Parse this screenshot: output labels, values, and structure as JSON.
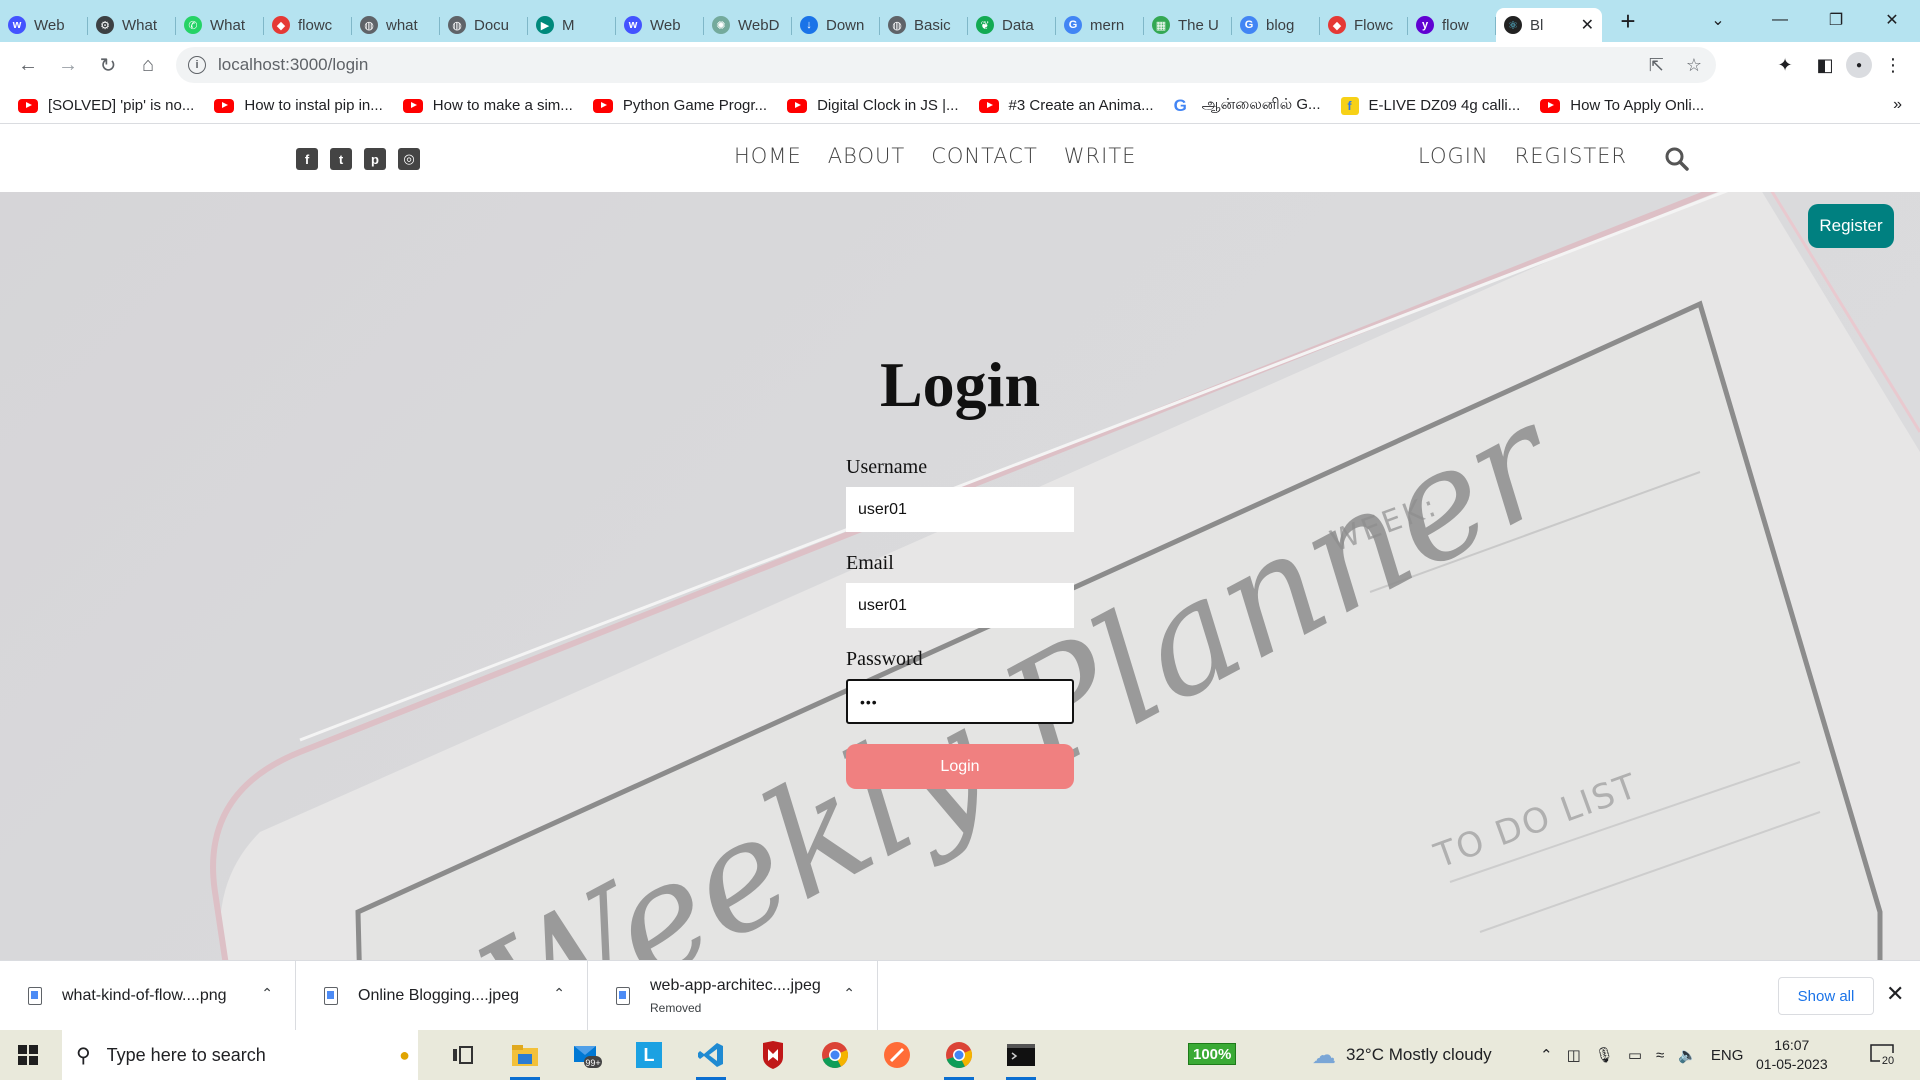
{
  "browser": {
    "tabs": [
      {
        "title": "Web",
        "icon": "webflow-icon",
        "color": "#4353ff"
      },
      {
        "title": "What",
        "icon": "robot-icon",
        "color": "#3c4043"
      },
      {
        "title": "What",
        "icon": "whatsapp-icon",
        "color": "#25d366"
      },
      {
        "title": "flowc",
        "icon": "diamond-icon",
        "color": "#e53935"
      },
      {
        "title": "what",
        "icon": "globe-icon",
        "color": "#5f6368"
      },
      {
        "title": "Docu",
        "icon": "globe-icon",
        "color": "#5f6368"
      },
      {
        "title": "M",
        "icon": "meet-icon",
        "color": "#00897b"
      },
      {
        "title": "Web",
        "icon": "webflow-icon",
        "color": "#4353ff"
      },
      {
        "title": "WebD",
        "icon": "chatgpt-icon",
        "color": "#74aa9c"
      },
      {
        "title": "Down",
        "icon": "download-icon",
        "color": "#1a73e8"
      },
      {
        "title": "Basic",
        "icon": "globe-icon",
        "color": "#5f6368"
      },
      {
        "title": "Data",
        "icon": "mongodb-icon",
        "color": "#13aa52"
      },
      {
        "title": "mern",
        "icon": "google-icon",
        "color": "#4285f4"
      },
      {
        "title": "The U",
        "icon": "sheet-icon",
        "color": "#34a853"
      },
      {
        "title": "blog",
        "icon": "google-icon",
        "color": "#4285f4"
      },
      {
        "title": "Flowc",
        "icon": "diamond-icon",
        "color": "#e53935"
      },
      {
        "title": "flow",
        "icon": "yahoo-icon",
        "color": "#6001d2"
      }
    ],
    "active_tab": {
      "title": "Bl",
      "icon": "react-icon",
      "color": "#61dafb"
    },
    "url": "localhost:3000/login",
    "bookmarks": [
      {
        "label": "[SOLVED] 'pip' is no...",
        "icon": "youtube-icon"
      },
      {
        "label": "How to instal pip in...",
        "icon": "youtube-icon"
      },
      {
        "label": "How to make a sim...",
        "icon": "youtube-icon"
      },
      {
        "label": "Python Game Progr...",
        "icon": "youtube-icon"
      },
      {
        "label": "Digital Clock in JS |...",
        "icon": "youtube-icon"
      },
      {
        "label": "#3 Create an Anima...",
        "icon": "youtube-icon"
      },
      {
        "label": "ஆன்லைனில் G...",
        "icon": "google-icon"
      },
      {
        "label": "E-LIVE DZ09 4g calli...",
        "icon": "flipkart-icon"
      },
      {
        "label": "How To Apply Onli...",
        "icon": "youtube-icon"
      }
    ]
  },
  "site": {
    "social_icons": [
      "facebook-icon",
      "twitter-icon",
      "pinterest-icon",
      "instagram-icon"
    ],
    "menu": [
      "HOME",
      "ABOUT",
      "CONTACT",
      "WRITE"
    ],
    "auth": [
      "LOGIN",
      "REGISTER"
    ],
    "register_button": "Register",
    "title": "Login",
    "form": {
      "username_label": "Username",
      "username_value": "user01",
      "email_label": "Email",
      "email_value": "user01",
      "password_label": "Password",
      "password_value": "•••",
      "submit_label": "Login"
    },
    "background_text": {
      "week": "WEEK:",
      "script": "Weekly Planner",
      "todo": "TO DO LIST"
    },
    "colors": {
      "register": "#008080",
      "login_button": "#f08080"
    }
  },
  "downloads": {
    "items": [
      {
        "name": "what-kind-of-flow....png",
        "status": ""
      },
      {
        "name": "Online Blogging....jpeg",
        "status": ""
      },
      {
        "name": "web-app-architec....jpeg",
        "status": "Removed"
      }
    ],
    "show_all": "Show all"
  },
  "taskbar": {
    "search_placeholder": "Type here to search",
    "mail_badge": "99+",
    "zoom": "100%",
    "weather": "32°C  Mostly cloudy",
    "language": "ENG",
    "time": "16:07",
    "date": "01-05-2023",
    "notifications": "20"
  }
}
